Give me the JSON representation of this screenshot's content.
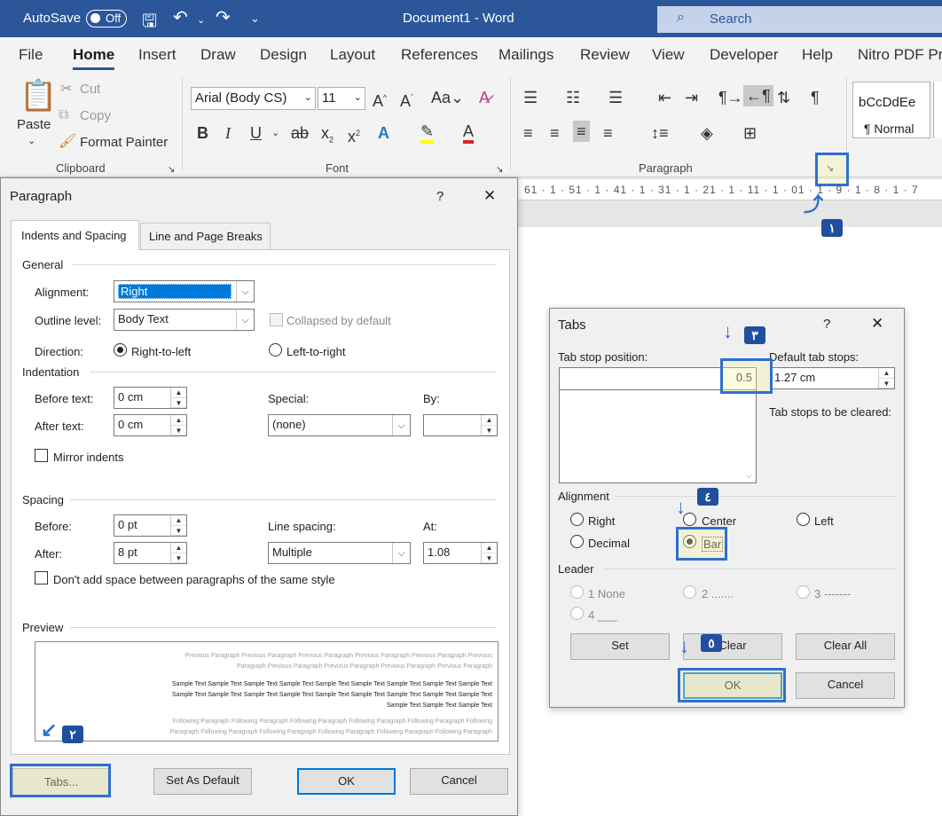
{
  "titlebar": {
    "autosave_label": "AutoSave",
    "autosave_state": "Off",
    "doc_title": "Document1  -  Word",
    "search_placeholder": "Search"
  },
  "menu_tabs": [
    "File",
    "Home",
    "Insert",
    "Draw",
    "Design",
    "Layout",
    "References",
    "Mailings",
    "Review",
    "View",
    "Developer",
    "Help",
    "Nitro PDF Pr"
  ],
  "ribbon": {
    "clipboard": {
      "paste": "Paste",
      "cut": "Cut",
      "copy": "Copy",
      "format_painter": "Format Painter",
      "label": "Clipboard"
    },
    "font": {
      "font_name": "Arial (Body CS)",
      "font_size": "11",
      "label": "Font"
    },
    "paragraph": {
      "label": "Paragraph"
    },
    "styles": {
      "sample": "bCcDdEe",
      "normal": "¶ Normal"
    }
  },
  "ruler": {
    "text": "61 · 1 · 51 · 1 · 41 · 1 · 31 · 1 · 21 · 1 · 11 · 1 · 01 · 1 · 9 · 1 · 8 · 1 · 7"
  },
  "paragraph_dialog": {
    "title": "Paragraph",
    "help": "?",
    "close": "✕",
    "tabs": [
      "Indents and Spacing",
      "Line and Page Breaks"
    ],
    "general": {
      "heading": "General",
      "alignment_label": "Alignment:",
      "alignment_value": "Right",
      "outline_label": "Outline level:",
      "outline_value": "Body Text",
      "collapsed_label": "Collapsed by default",
      "direction_label": "Direction:",
      "rtl_label": "Right-to-left",
      "ltr_label": "Left-to-right"
    },
    "indentation": {
      "heading": "Indentation",
      "before_label": "Before text:",
      "before_value": "0 cm",
      "after_label": "After text:",
      "after_value": "0 cm",
      "special_label": "Special:",
      "special_value": "(none)",
      "by_label": "By:",
      "by_value": "",
      "mirror_label": "Mirror indents"
    },
    "spacing": {
      "heading": "Spacing",
      "before_label": "Before:",
      "before_value": "0 pt",
      "after_label": "After:",
      "after_value": "8 pt",
      "line_spacing_label": "Line spacing:",
      "line_spacing_value": "Multiple",
      "at_label": "At:",
      "at_value": "1.08",
      "dont_add_label": "Don't add space between paragraphs of the same style"
    },
    "preview": {
      "heading": "Preview",
      "prev_1": "Previous Paragraph Previous Paragraph Previous Paragraph Previous Paragraph Previous Paragraph Previous",
      "prev_2": "Paragraph Previous Paragraph Previous Paragraph Previous Paragraph Previous Paragraph",
      "sample_1": "Sample Text Sample Text Sample Text Sample Text Sample Text Sample Text Sample Text Sample Text Sample Text",
      "sample_2": "Sample Text Sample Text Sample Text Sample Text Sample Text Sample Text Sample Text Sample Text Sample Text",
      "sample_3": "Sample Text Sample Text Sample Text",
      "next_1": "Following Paragraph Following Paragraph Following Paragraph Following Paragraph Following Paragraph Following",
      "next_2": "Paragraph Following Paragraph Following Paragraph Following Paragraph Following Paragraph Following Paragraph"
    },
    "buttons": {
      "tabs": "Tabs...",
      "set_default": "Set As Default",
      "ok": "OK",
      "cancel": "Cancel"
    }
  },
  "tabs_dialog": {
    "title": "Tabs",
    "help": "?",
    "close": "✕",
    "tab_stop_label": "Tab stop position:",
    "tab_stop_value": "0.5",
    "default_label": "Default tab stops:",
    "default_value": "1.27 cm",
    "cleared_label": "Tab stops to be cleared:",
    "alignment_heading": "Alignment",
    "align_right": "Right",
    "align_center": "Center",
    "align_left": "Left",
    "align_decimal": "Decimal",
    "align_bar": "Bar",
    "leader_heading": "Leader",
    "leader_1": "1 None",
    "leader_2": "2 .......",
    "leader_3": "3 -------",
    "leader_4": "4 ___",
    "buttons": {
      "set": "Set",
      "clear": "Clear",
      "clear_all": "Clear All",
      "ok": "OK",
      "cancel": "Cancel"
    }
  },
  "step_markers": [
    "١",
    "٢",
    "٣",
    "٤",
    "٥"
  ],
  "colors": {
    "word_blue": "#2b579a",
    "highlight_border": "#2f6fcf",
    "highlight_fill": "#f0f4aa",
    "marker_bg": "#1f4f9e"
  }
}
